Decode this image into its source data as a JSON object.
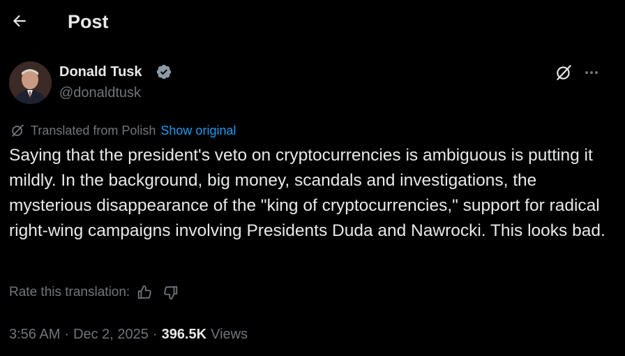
{
  "header": {
    "title": "Post",
    "back_icon": "arrow-left-icon"
  },
  "author": {
    "name": "Donald Tusk",
    "handle": "@donaldtusk",
    "verified_color": "#8b98a5"
  },
  "actions": {
    "grok_icon": "grok-icon",
    "more_icon": "more-horizontal-icon"
  },
  "translation": {
    "label": "Translated from Polish",
    "show_original": "Show original",
    "rate_label": "Rate this translation:"
  },
  "post": {
    "text": "Saying that the president's veto on cryptocurrencies is ambiguous is putting it mildly. In the background, big money, scandals and investigations, the mysterious disappearance of the \"king of cryptocurrencies,\" support for radical right-wing campaigns involving Presidents Duda and Nawrocki. This looks bad."
  },
  "meta": {
    "time": "3:56 AM",
    "separator": "·",
    "date": "Dec 2, 2025",
    "views_count": "396.5K",
    "views_label": "Views"
  },
  "colors": {
    "background": "#000000",
    "text_primary": "#e7e9ea",
    "text_secondary": "#71767b",
    "link": "#1d9bf0"
  }
}
